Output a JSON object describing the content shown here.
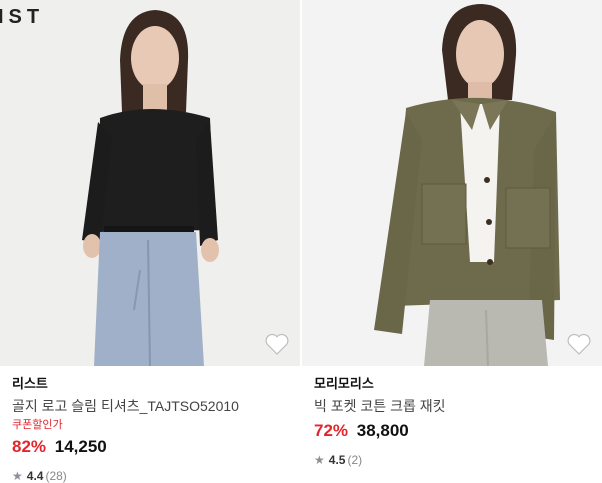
{
  "products": [
    {
      "brand_mark": "IST",
      "brand": "리스트",
      "name": "골지 로고 슬림 티셔츠_TAJTSO52010",
      "coupon_label": "쿠폰할인가",
      "discount": "82%",
      "price": "14,250",
      "rating": "4.4",
      "review_count": "(28)"
    },
    {
      "brand": "모리모리스",
      "name": "빅 포켓 코튼 크롭 재킷",
      "discount": "72%",
      "price": "38,800",
      "rating": "4.5",
      "review_count": "(2)"
    }
  ],
  "icons": {
    "wishlist": "heart-icon",
    "rating": "star-icon"
  },
  "colors": {
    "discount": "#e2262c",
    "star": "#8a8f98"
  }
}
